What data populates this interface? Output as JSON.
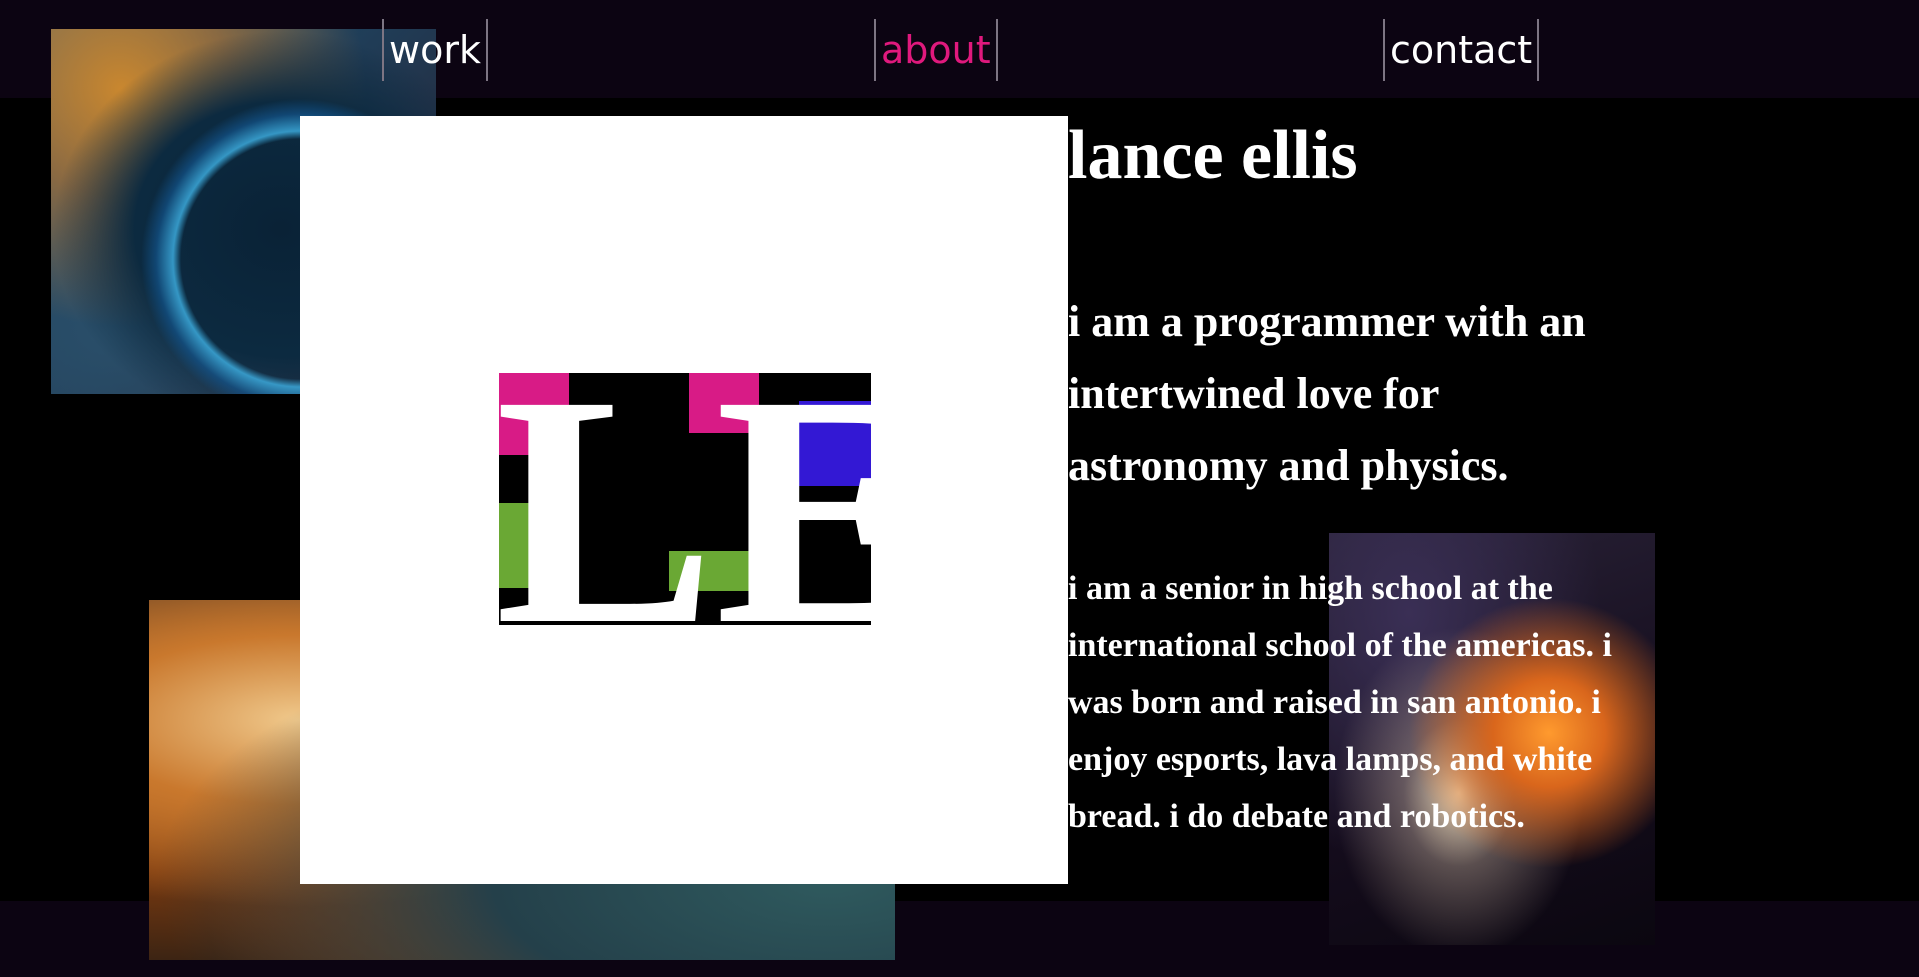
{
  "nav": {
    "items": [
      {
        "label": "work"
      },
      {
        "label": "about",
        "active": true
      },
      {
        "label": "contact"
      }
    ],
    "active_color": "#e0197d",
    "text_color": "#ffffff"
  },
  "logo": {
    "text": "LE",
    "colors": {
      "pink": "#d81b86",
      "blue": "#3318d4",
      "green": "#6aa834",
      "black": "#000000"
    }
  },
  "about": {
    "name": "lance ellis",
    "intro": "i am a programmer with an intertwined love for astronomy and physics.",
    "bio": "i am a senior in high school at the international school of the americas. i was born and raised in san antonio. i enjoy esports, lava lamps, and white bread. i do debate and robotics."
  },
  "background": {
    "page_color": "#000000",
    "bar_color": "#0c0412",
    "images": [
      "bubble-nebula-photo",
      "carina-nebula-photo",
      "fluid-art-photo"
    ]
  }
}
